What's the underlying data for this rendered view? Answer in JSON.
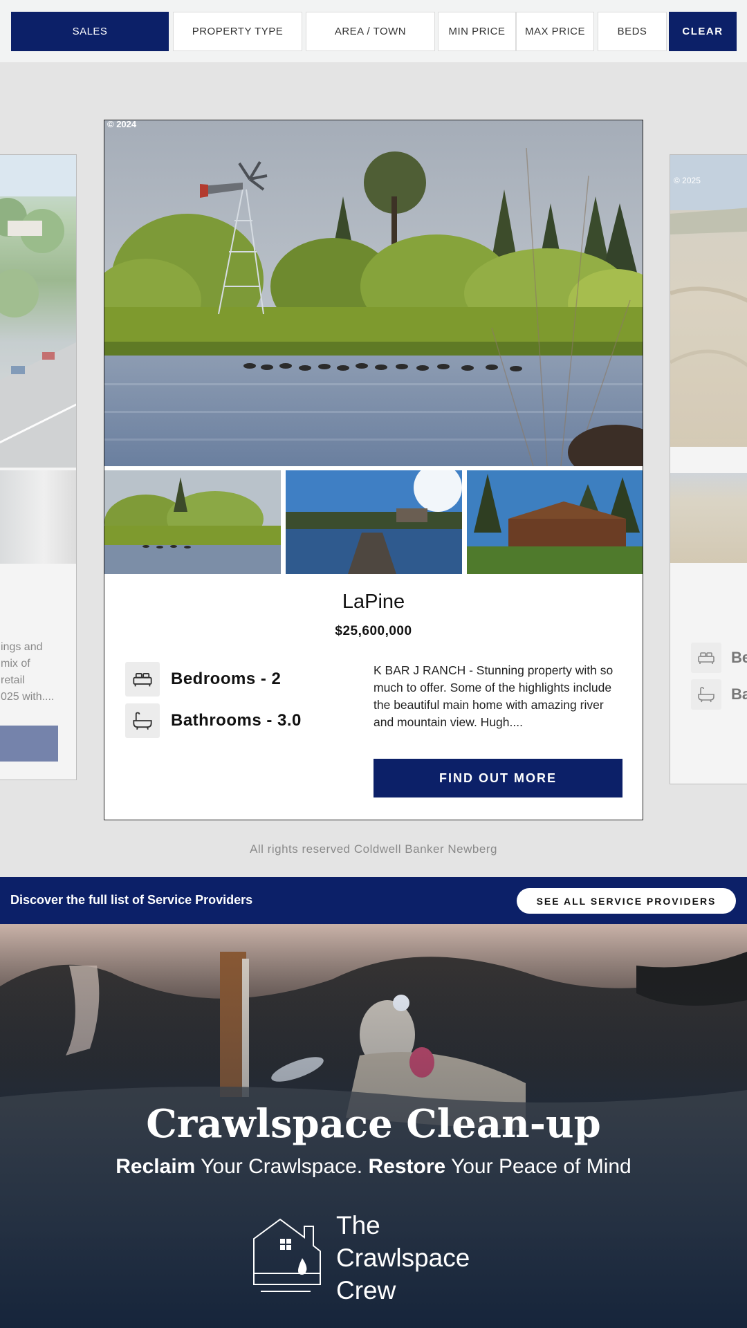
{
  "filters": {
    "sales": "SALES",
    "property_type": "PROPERTY TYPE",
    "area_town": "AREA / TOWN",
    "min_price": "MIN PRICE",
    "max_price": "MAX PRICE",
    "beds": "BEDS",
    "clear": "CLEAR"
  },
  "left_card": {
    "description_lines": [
      "ings and",
      "mix of",
      "retail",
      "025 with...."
    ]
  },
  "right_card": {
    "copyright": "© 2025",
    "bedrooms_label": "Be",
    "bathrooms_label": "Ba"
  },
  "listing": {
    "copyright": "© 2024",
    "city": "LaPine",
    "price": "$25,600,000",
    "bedrooms": "Bedrooms - 2",
    "bathrooms": "Bathrooms - 3.0",
    "description": "K BAR J RANCH - Stunning property with so much to offer. Some of the highlights include the beautiful main home with amazing river and mountain view. Hugh....",
    "cta": "FIND OUT MORE"
  },
  "footer": {
    "rights": "All rights reserved Coldwell Banker Newberg"
  },
  "service_banner": {
    "text": "Discover the full list of Service Providers",
    "button": "SEE ALL SERVICE PROVIDERS"
  },
  "ad": {
    "title": "Crawlspace Clean-up",
    "sub_bold_1": "Reclaim",
    "sub_text_1": " Your Crawlspace. ",
    "sub_bold_2": "Restore",
    "sub_text_2": " Your Peace of Mind",
    "logo_line_1": "The",
    "logo_line_2": "Crawlspace",
    "logo_line_3": "Crew"
  },
  "colors": {
    "brand_navy": "#0c2068",
    "page_bg": "#e4e4e4"
  }
}
